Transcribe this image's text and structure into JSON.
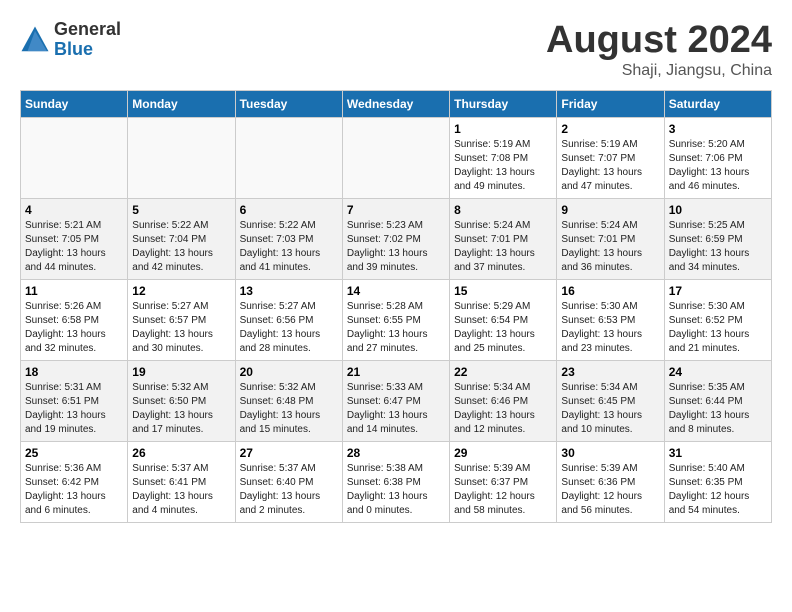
{
  "header": {
    "logo_line1": "General",
    "logo_line2": "Blue",
    "month": "August 2024",
    "location": "Shaji, Jiangsu, China"
  },
  "weekdays": [
    "Sunday",
    "Monday",
    "Tuesday",
    "Wednesday",
    "Thursday",
    "Friday",
    "Saturday"
  ],
  "weeks": [
    [
      {
        "day": "",
        "info": ""
      },
      {
        "day": "",
        "info": ""
      },
      {
        "day": "",
        "info": ""
      },
      {
        "day": "",
        "info": ""
      },
      {
        "day": "1",
        "info": "Sunrise: 5:19 AM\nSunset: 7:08 PM\nDaylight: 13 hours\nand 49 minutes."
      },
      {
        "day": "2",
        "info": "Sunrise: 5:19 AM\nSunset: 7:07 PM\nDaylight: 13 hours\nand 47 minutes."
      },
      {
        "day": "3",
        "info": "Sunrise: 5:20 AM\nSunset: 7:06 PM\nDaylight: 13 hours\nand 46 minutes."
      }
    ],
    [
      {
        "day": "4",
        "info": "Sunrise: 5:21 AM\nSunset: 7:05 PM\nDaylight: 13 hours\nand 44 minutes."
      },
      {
        "day": "5",
        "info": "Sunrise: 5:22 AM\nSunset: 7:04 PM\nDaylight: 13 hours\nand 42 minutes."
      },
      {
        "day": "6",
        "info": "Sunrise: 5:22 AM\nSunset: 7:03 PM\nDaylight: 13 hours\nand 41 minutes."
      },
      {
        "day": "7",
        "info": "Sunrise: 5:23 AM\nSunset: 7:02 PM\nDaylight: 13 hours\nand 39 minutes."
      },
      {
        "day": "8",
        "info": "Sunrise: 5:24 AM\nSunset: 7:01 PM\nDaylight: 13 hours\nand 37 minutes."
      },
      {
        "day": "9",
        "info": "Sunrise: 5:24 AM\nSunset: 7:01 PM\nDaylight: 13 hours\nand 36 minutes."
      },
      {
        "day": "10",
        "info": "Sunrise: 5:25 AM\nSunset: 6:59 PM\nDaylight: 13 hours\nand 34 minutes."
      }
    ],
    [
      {
        "day": "11",
        "info": "Sunrise: 5:26 AM\nSunset: 6:58 PM\nDaylight: 13 hours\nand 32 minutes."
      },
      {
        "day": "12",
        "info": "Sunrise: 5:27 AM\nSunset: 6:57 PM\nDaylight: 13 hours\nand 30 minutes."
      },
      {
        "day": "13",
        "info": "Sunrise: 5:27 AM\nSunset: 6:56 PM\nDaylight: 13 hours\nand 28 minutes."
      },
      {
        "day": "14",
        "info": "Sunrise: 5:28 AM\nSunset: 6:55 PM\nDaylight: 13 hours\nand 27 minutes."
      },
      {
        "day": "15",
        "info": "Sunrise: 5:29 AM\nSunset: 6:54 PM\nDaylight: 13 hours\nand 25 minutes."
      },
      {
        "day": "16",
        "info": "Sunrise: 5:30 AM\nSunset: 6:53 PM\nDaylight: 13 hours\nand 23 minutes."
      },
      {
        "day": "17",
        "info": "Sunrise: 5:30 AM\nSunset: 6:52 PM\nDaylight: 13 hours\nand 21 minutes."
      }
    ],
    [
      {
        "day": "18",
        "info": "Sunrise: 5:31 AM\nSunset: 6:51 PM\nDaylight: 13 hours\nand 19 minutes."
      },
      {
        "day": "19",
        "info": "Sunrise: 5:32 AM\nSunset: 6:50 PM\nDaylight: 13 hours\nand 17 minutes."
      },
      {
        "day": "20",
        "info": "Sunrise: 5:32 AM\nSunset: 6:48 PM\nDaylight: 13 hours\nand 15 minutes."
      },
      {
        "day": "21",
        "info": "Sunrise: 5:33 AM\nSunset: 6:47 PM\nDaylight: 13 hours\nand 14 minutes."
      },
      {
        "day": "22",
        "info": "Sunrise: 5:34 AM\nSunset: 6:46 PM\nDaylight: 13 hours\nand 12 minutes."
      },
      {
        "day": "23",
        "info": "Sunrise: 5:34 AM\nSunset: 6:45 PM\nDaylight: 13 hours\nand 10 minutes."
      },
      {
        "day": "24",
        "info": "Sunrise: 5:35 AM\nSunset: 6:44 PM\nDaylight: 13 hours\nand 8 minutes."
      }
    ],
    [
      {
        "day": "25",
        "info": "Sunrise: 5:36 AM\nSunset: 6:42 PM\nDaylight: 13 hours\nand 6 minutes."
      },
      {
        "day": "26",
        "info": "Sunrise: 5:37 AM\nSunset: 6:41 PM\nDaylight: 13 hours\nand 4 minutes."
      },
      {
        "day": "27",
        "info": "Sunrise: 5:37 AM\nSunset: 6:40 PM\nDaylight: 13 hours\nand 2 minutes."
      },
      {
        "day": "28",
        "info": "Sunrise: 5:38 AM\nSunset: 6:38 PM\nDaylight: 13 hours\nand 0 minutes."
      },
      {
        "day": "29",
        "info": "Sunrise: 5:39 AM\nSunset: 6:37 PM\nDaylight: 12 hours\nand 58 minutes."
      },
      {
        "day": "30",
        "info": "Sunrise: 5:39 AM\nSunset: 6:36 PM\nDaylight: 12 hours\nand 56 minutes."
      },
      {
        "day": "31",
        "info": "Sunrise: 5:40 AM\nSunset: 6:35 PM\nDaylight: 12 hours\nand 54 minutes."
      }
    ]
  ]
}
